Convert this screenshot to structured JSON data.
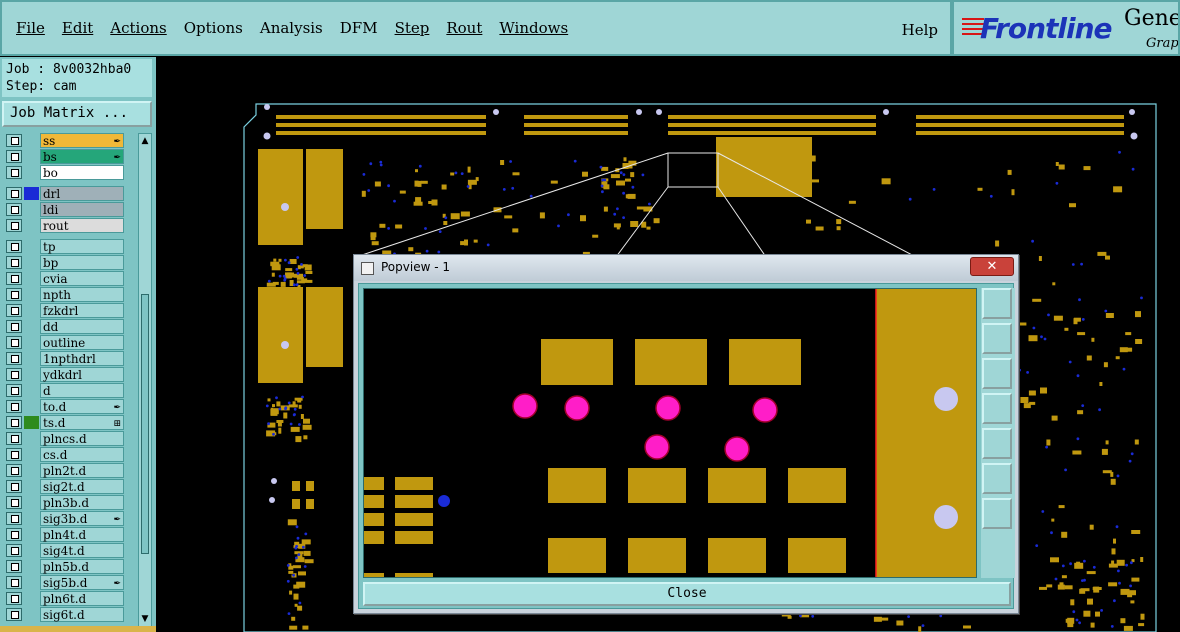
{
  "menu": {
    "items": [
      "File",
      "Edit",
      "Actions",
      "Options",
      "Analysis",
      "DFM",
      "Step",
      "Rout",
      "Windows"
    ],
    "help": "Help"
  },
  "logo": {
    "brand": "Frontline",
    "product": "Genes",
    "sub": "Graph"
  },
  "job": {
    "job_line": "Job : 8v0032hba0",
    "step_line": "Step: cam",
    "matrix_button": "Job Matrix ..."
  },
  "layers": [
    {
      "name": "ss",
      "color": "#f0b838",
      "swatch": "",
      "mark": "✒"
    },
    {
      "name": "bs",
      "color": "#25a67a",
      "swatch": "",
      "mark": "✒"
    },
    {
      "name": "bo",
      "color": "#ffffff",
      "swatch": "",
      "mark": ""
    },
    {
      "name": "drl",
      "color": "#9fb0b8",
      "swatch": "#1a2bd6",
      "mark": ""
    },
    {
      "name": "ldi",
      "color": "#9fb0b8",
      "swatch": "",
      "mark": ""
    },
    {
      "name": "rout",
      "color": "#dcdcdc",
      "swatch": "",
      "mark": ""
    },
    {
      "name": "tp",
      "color": "#9fd6d6",
      "swatch": "",
      "mark": ""
    },
    {
      "name": "bp",
      "color": "#9fd6d6",
      "swatch": "",
      "mark": ""
    },
    {
      "name": "cvia",
      "color": "#9fd6d6",
      "swatch": "",
      "mark": ""
    },
    {
      "name": "npth",
      "color": "#9fd6d6",
      "swatch": "",
      "mark": ""
    },
    {
      "name": "fzkdrl",
      "color": "#9fd6d6",
      "swatch": "",
      "mark": ""
    },
    {
      "name": "dd",
      "color": "#9fd6d6",
      "swatch": "",
      "mark": ""
    },
    {
      "name": "outline",
      "color": "#9fd6d6",
      "swatch": "",
      "mark": ""
    },
    {
      "name": "1npthdrl",
      "color": "#9fd6d6",
      "swatch": "",
      "mark": ""
    },
    {
      "name": "ydkdrl",
      "color": "#9fd6d6",
      "swatch": "",
      "mark": ""
    },
    {
      "name": "d",
      "color": "#9fd6d6",
      "swatch": "",
      "mark": ""
    },
    {
      "name": "to.d",
      "color": "#9fd6d6",
      "swatch": "",
      "mark": "✒"
    },
    {
      "name": "ts.d",
      "color": "#9fd6d6",
      "swatch": "#2e8b1e",
      "mark": "⊞"
    },
    {
      "name": "plncs.d",
      "color": "#9fd6d6",
      "swatch": "",
      "mark": ""
    },
    {
      "name": "cs.d",
      "color": "#9fd6d6",
      "swatch": "",
      "mark": ""
    },
    {
      "name": "pln2t.d",
      "color": "#9fd6d6",
      "swatch": "",
      "mark": ""
    },
    {
      "name": "sig2t.d",
      "color": "#9fd6d6",
      "swatch": "",
      "mark": ""
    },
    {
      "name": "pln3b.d",
      "color": "#9fd6d6",
      "swatch": "",
      "mark": ""
    },
    {
      "name": "sig3b.d",
      "color": "#9fd6d6",
      "swatch": "",
      "mark": "✒"
    },
    {
      "name": "pln4t.d",
      "color": "#9fd6d6",
      "swatch": "",
      "mark": ""
    },
    {
      "name": "sig4t.d",
      "color": "#9fd6d6",
      "swatch": "",
      "mark": ""
    },
    {
      "name": "pln5b.d",
      "color": "#9fd6d6",
      "swatch": "",
      "mark": ""
    },
    {
      "name": "sig5b.d",
      "color": "#9fd6d6",
      "swatch": "",
      "mark": "✒"
    },
    {
      "name": "pln6t.d",
      "color": "#9fd6d6",
      "swatch": "",
      "mark": ""
    },
    {
      "name": "sig6t.d",
      "color": "#9fd6d6",
      "swatch": "",
      "mark": ""
    }
  ],
  "popview": {
    "title": "Popview - 1",
    "close_label": "Close",
    "close_x": "✕"
  },
  "colors": {
    "panel": "#9fd6d6",
    "copper": "#c0980f",
    "magenta": "#ff1ec8",
    "via": "#1a2bd6",
    "pad_lavender": "#c8c8f0"
  },
  "icons": [
    "zoom-fit-icon",
    "home-icon",
    "zoom-home-icon",
    "zoom-in-icon",
    "zoom-out-icon",
    "fit-all-icon",
    "pan-icon"
  ]
}
